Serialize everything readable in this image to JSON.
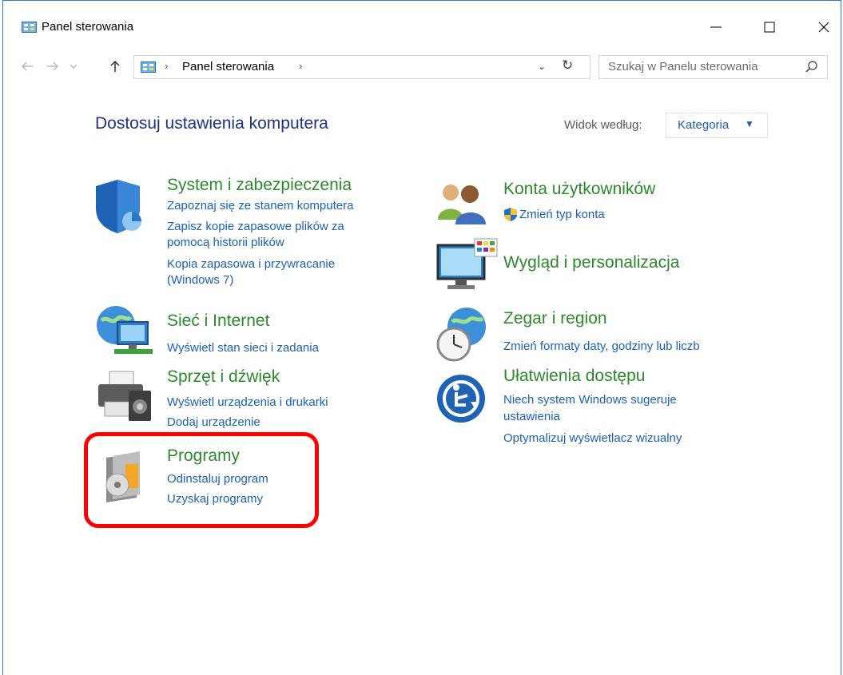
{
  "window": {
    "title": "Panel sterowania",
    "controls": {
      "minimize": "—",
      "maximize": "☐",
      "close": "✕"
    }
  },
  "address": {
    "breadcrumb": [
      "Panel sterowania"
    ],
    "separator": "›",
    "search_placeholder": "Szukaj w Panelu sterowania"
  },
  "header": {
    "title": "Dostosuj ustawienia komputera",
    "view_by_label": "Widok według:",
    "view_by_value": "Kategoria"
  },
  "categories": {
    "system": {
      "title": "System i zabezpieczenia",
      "links": [
        "Zapoznaj się ze stanem komputera",
        "Zapisz kopie zapasowe plików za",
        "pomocą historii plików",
        "Kopia zapasowa i przywracanie",
        "(Windows 7)"
      ]
    },
    "network": {
      "title": "Sieć i Internet",
      "links": [
        "Wyświetl stan sieci i zadania"
      ]
    },
    "hardware": {
      "title": "Sprzęt i dźwięk",
      "links": [
        "Wyświetl urządzenia i drukarki",
        "Dodaj urządzenie"
      ]
    },
    "programs": {
      "title": "Programy",
      "links": [
        "Odinstaluj program",
        "Uzyskaj programy"
      ]
    },
    "accounts": {
      "title": "Konta użytkowników",
      "links": [
        "Zmień typ konta"
      ]
    },
    "appearance": {
      "title": "Wygląd i personalizacja",
      "links": []
    },
    "clock": {
      "title": "Zegar i region",
      "links": [
        "Zmień formaty daty, godziny lub liczb"
      ]
    },
    "ease": {
      "title": "Ułatwienia dostępu",
      "links": [
        "Niech system Windows sugeruje",
        "ustawienia",
        "Optymalizuj wyświetlacz wizualny"
      ]
    }
  },
  "colors": {
    "category_title": "#2c8a2c",
    "link": "#1a62b8",
    "heading": "#1e3287",
    "highlight": "#ff0000"
  }
}
